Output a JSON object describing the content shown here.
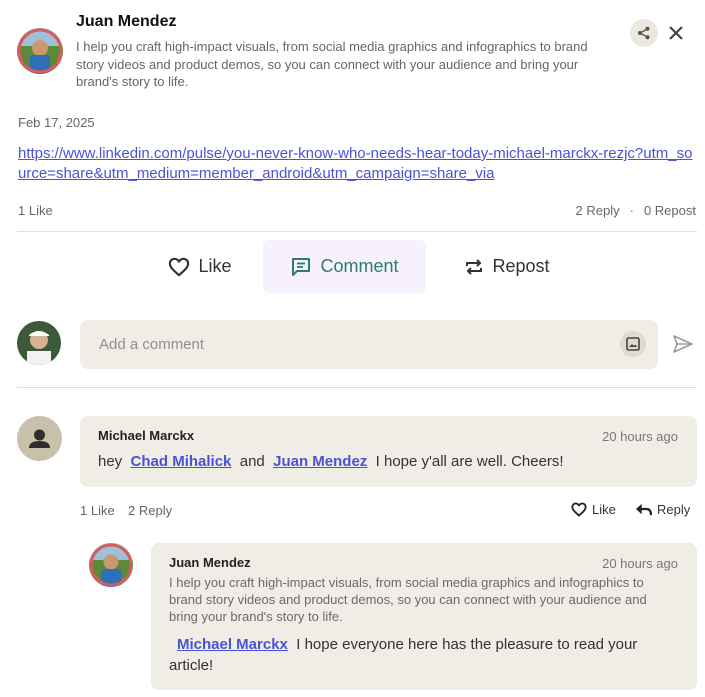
{
  "post": {
    "author_name": "Juan Mendez",
    "author_bio": "I help you craft high-impact visuals, from social media graphics and infographics to brand story videos and product demos, so you can connect with your audience and bring your brand's story to life.",
    "date": "Feb 17, 2025",
    "link": "https://www.linkedin.com/pulse/you-never-know-who-needs-hear-today-michael-marckx-rezjc?utm_source=share&utm_medium=member_android&utm_campaign=share_via",
    "likes": "1 Like",
    "replies": "2 Reply",
    "separator": "·",
    "reposts": "0 Repost"
  },
  "header_icons": {
    "share": "share-icon",
    "close": "close-icon"
  },
  "actions": {
    "like": "Like",
    "comment": "Comment",
    "repost": "Repost"
  },
  "composer": {
    "placeholder": "Add a comment"
  },
  "comments": [
    {
      "author": "Michael Marckx",
      "time": "20 hours ago",
      "text_prefix": "hey",
      "mention1": "Chad Mihalick",
      "text_mid": "and",
      "mention2": "Juan Mendez",
      "text_suffix": "I hope y'all are well. Cheers!",
      "likes": "1 Like",
      "replies": "2 Reply",
      "like_label": "Like",
      "reply_label": "Reply"
    }
  ],
  "reply": {
    "author": "Juan Mendez",
    "time": "20 hours ago",
    "bio": "I help you craft high-impact visuals, from social media graphics and infographics to brand story videos and product demos, so you can connect with your audience and bring your brand's story to life.",
    "mention": "Michael Marckx",
    "text": "I hope everyone here has the pleasure to read your article!"
  },
  "colors": {
    "accent": "#2a7d6e",
    "link": "#4a52d6",
    "bubble": "#efede6"
  }
}
